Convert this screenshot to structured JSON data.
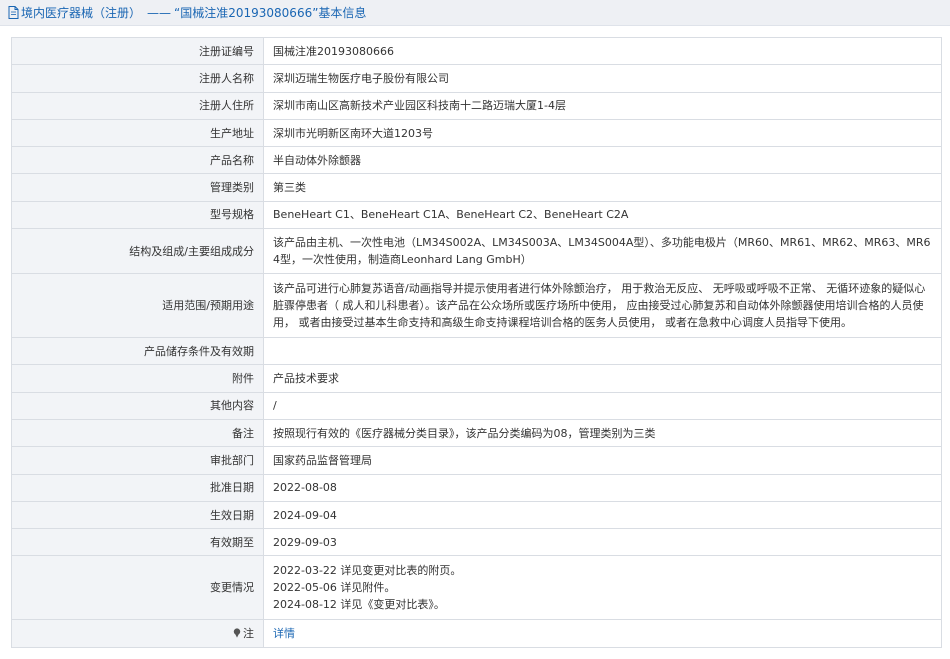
{
  "header": {
    "breadcrumb": "境内医疗器械（注册）",
    "separator": "——",
    "title": "“国械注准20193080666”基本信息"
  },
  "rows": [
    {
      "label": "注册证编号",
      "value": "国械注准20193080666"
    },
    {
      "label": "注册人名称",
      "value": "深圳迈瑞生物医疗电子股份有限公司"
    },
    {
      "label": "注册人住所",
      "value": "深圳市南山区高新技术产业园区科技南十二路迈瑞大厦1-4层"
    },
    {
      "label": "生产地址",
      "value": "深圳市光明新区南环大道1203号"
    },
    {
      "label": "产品名称",
      "value": "半自动体外除颤器"
    },
    {
      "label": "管理类别",
      "value": "第三类"
    },
    {
      "label": "型号规格",
      "value": "BeneHeart C1、BeneHeart C1A、BeneHeart C2、BeneHeart C2A"
    },
    {
      "label": "结构及组成/主要组成成分",
      "value": "该产品由主机、一次性电池（LM34S002A、LM34S003A、LM34S004A型）、多功能电极片（MR60、MR61、MR62、MR63、MR64型，一次性使用，制造商Leonhard Lang GmbH）"
    },
    {
      "label": "适用范围/预期用途",
      "value": "该产品可进行心肺复苏语音/动画指导并提示使用者进行体外除颤治疗， 用于救治无反应、 无呼吸或呼吸不正常、 无循环迹象的疑似心脏骤停患者（ 成人和儿科患者）。该产品在公众场所或医疗场所中使用， 应由接受过心肺复苏和自动体外除颤器使用培训合格的人员使用， 或者由接受过基本生命支持和高级生命支持课程培训合格的医务人员使用， 或者在急救中心调度人员指导下使用。"
    },
    {
      "label": "产品储存条件及有效期",
      "value": ""
    },
    {
      "label": "附件",
      "value": "产品技术要求"
    },
    {
      "label": "其他内容",
      "value": "/"
    },
    {
      "label": "备注",
      "value": "按照现行有效的《医疗器械分类目录》，该产品分类编码为08，管理类别为三类"
    },
    {
      "label": "审批部门",
      "value": "国家药品监督管理局"
    },
    {
      "label": "批准日期",
      "value": "2022-08-08"
    },
    {
      "label": "生效日期",
      "value": "2024-09-04"
    },
    {
      "label": "有效期至",
      "value": "2029-09-03"
    }
  ],
  "changes": {
    "label": "变更情况",
    "lines": [
      "2022-03-22 详见变更对比表的附页。",
      "2022-05-06 详见附件。",
      "2024-08-12 详见《变更对比表》。"
    ]
  },
  "note": {
    "label": "注",
    "link_text": "详情"
  },
  "colors": {
    "link": "#1a66b3",
    "label_bg": "#f2f4f7",
    "title_bg": "#eef0f4",
    "border": "#d9dde3"
  }
}
